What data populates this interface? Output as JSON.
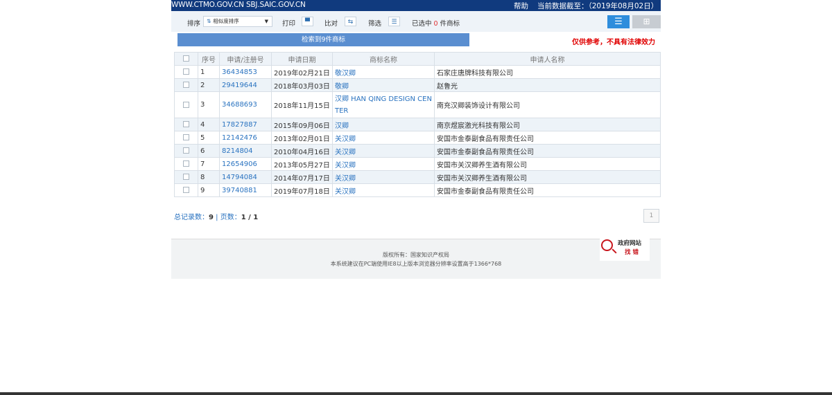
{
  "topbar": {
    "site": "WWW.CTMO.GOV.CN SBJ.SAIC.GOV.CN",
    "help": "帮助",
    "date": "当前数据截至：（2019年08月02日）"
  },
  "toolbar": {
    "sort_label": "排序",
    "sort_value": "相似度排序",
    "print_label": "打印",
    "compare_label": "比对",
    "filter_label": "筛选",
    "selected_prefix": "已选中",
    "selected_count": "0",
    "selected_suffix": "件商标"
  },
  "result_bar": "检索到9件商标",
  "disclaimer": "仅供参考，不具有法律效力",
  "table": {
    "headers": [
      "序号",
      "申请/注册号",
      "申请日期",
      "商标名称",
      "申请人名称"
    ],
    "rows": [
      {
        "no": "1",
        "reg": "36434853",
        "date": "2019年02月21日",
        "name": "敬汉卿",
        "applicant": "石家庄唐牌科技有限公司"
      },
      {
        "no": "2",
        "reg": "29419644",
        "date": "2018年03月03日",
        "name": "敬卿",
        "applicant": "赵鲁光"
      },
      {
        "no": "3",
        "reg": "34688693",
        "date": "2018年11月15日",
        "name": "汉卿 HAN QING DESIGN CENTER",
        "applicant": "南充汉卿装饰设计有限公司"
      },
      {
        "no": "4",
        "reg": "17827887",
        "date": "2015年09月06日",
        "name": "汉卿",
        "applicant": "南京煜宸激光科技有限公司"
      },
      {
        "no": "5",
        "reg": "12142476",
        "date": "2013年02月01日",
        "name": "关汉卿",
        "applicant": "安国市金泰副食品有限责任公司"
      },
      {
        "no": "6",
        "reg": "8214804",
        "date": "2010年04月16日",
        "name": "关汉卿",
        "applicant": "安国市金泰副食品有限责任公司"
      },
      {
        "no": "7",
        "reg": "12654906",
        "date": "2013年05月27日",
        "name": "关汉卿",
        "applicant": "安国市关汉卿养生酒有限公司"
      },
      {
        "no": "8",
        "reg": "14794084",
        "date": "2014年07月17日",
        "name": "关汉卿",
        "applicant": "安国市关汉卿养生酒有限公司"
      },
      {
        "no": "9",
        "reg": "39740881",
        "date": "2019年07月18日",
        "name": "关汉卿",
        "applicant": "安国市金泰副食品有限责任公司"
      }
    ]
  },
  "pager": {
    "total_label": "总记录数：",
    "total": "9",
    "sep": " | ",
    "pages_label": "页数：",
    "pages": "1 / 1",
    "current_page": "1"
  },
  "footer": {
    "copyright": "版权所有：国家知识产权局",
    "note": "本系统建议在PC端使用IE8以上版本浏览器分辨率设置高于1366*768",
    "badge_line1": "政府网站",
    "badge_line2": "找 错"
  }
}
